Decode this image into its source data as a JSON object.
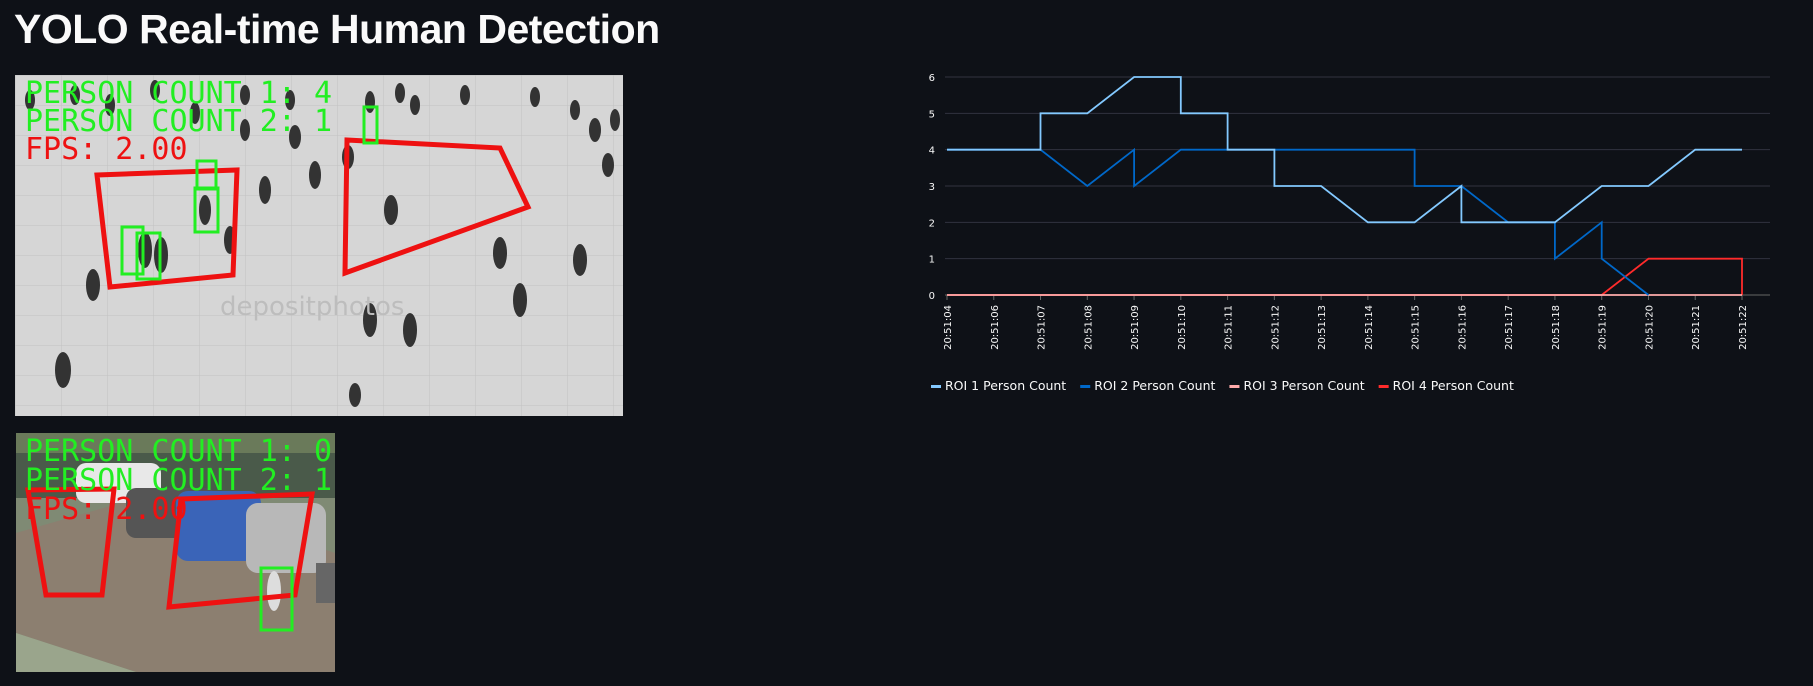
{
  "title": "YOLO Real-time Human Detection",
  "feeds": [
    {
      "overlay": {
        "line1": "PERSON COUNT 1: 4",
        "line2": "PERSON COUNT 2: 1",
        "line3": "FPS: 2.00"
      },
      "watermark": "depositphotos"
    },
    {
      "overlay": {
        "line1": "PERSON COUNT 1: 0",
        "line2": "PERSON COUNT 2: 1",
        "line3": "FPS: 2.00"
      }
    }
  ],
  "colors": {
    "roi1": "#83c9ff",
    "roi2": "#0068c9",
    "roi3": "#ffabab",
    "roi4": "#ff2b2b",
    "box": "#22ee22",
    "roi_poly": "#ee1111"
  },
  "chart_data": {
    "type": "line",
    "x": [
      "20:51:04",
      "20:51:06",
      "20:51:07",
      "20:51:08",
      "20:51:09",
      "20:51:10",
      "20:51:11",
      "20:51:12",
      "20:51:13",
      "20:51:14",
      "20:51:15",
      "20:51:16",
      "20:51:17",
      "20:51:18",
      "20:51:19",
      "20:51:20",
      "20:51:21",
      "20:51:22"
    ],
    "ylim": [
      0,
      6
    ],
    "yticks": [
      0,
      1,
      2,
      3,
      4,
      5,
      6
    ],
    "legend_position": "bottom",
    "series": [
      {
        "name": "ROI 1 Person Count",
        "color": "#83c9ff",
        "points": [
          [
            0,
            4
          ],
          [
            2,
            4
          ],
          [
            2,
            5
          ],
          [
            3,
            5
          ],
          [
            4,
            6
          ],
          [
            5,
            6
          ],
          [
            5,
            5
          ],
          [
            6,
            5
          ],
          [
            6,
            4
          ],
          [
            7,
            4
          ],
          [
            7,
            3
          ],
          [
            8,
            3
          ],
          [
            9,
            2
          ],
          [
            10,
            2
          ],
          [
            11,
            3
          ],
          [
            11,
            2
          ],
          [
            12,
            2
          ],
          [
            13,
            2
          ],
          [
            14,
            3
          ],
          [
            15,
            3
          ],
          [
            16,
            4
          ],
          [
            17,
            4
          ]
        ]
      },
      {
        "name": "ROI 2 Person Count",
        "color": "#0068c9",
        "points": [
          [
            0,
            4
          ],
          [
            2,
            4
          ],
          [
            3,
            3
          ],
          [
            4,
            4
          ],
          [
            4,
            3
          ],
          [
            5,
            4
          ],
          [
            6,
            4
          ],
          [
            7,
            4
          ],
          [
            8,
            4
          ],
          [
            9,
            4
          ],
          [
            10,
            4
          ],
          [
            10,
            3
          ],
          [
            11,
            3
          ],
          [
            12,
            2
          ],
          [
            13,
            2
          ],
          [
            13,
            1
          ],
          [
            14,
            2
          ],
          [
            14,
            1
          ],
          [
            15,
            0
          ]
        ]
      },
      {
        "name": "ROI 3 Person Count",
        "color": "#ffabab",
        "points": [
          [
            0,
            0
          ],
          [
            14,
            0
          ],
          [
            15,
            0
          ],
          [
            16,
            0
          ],
          [
            17,
            0
          ]
        ]
      },
      {
        "name": "ROI 4 Person Count",
        "color": "#ff2b2b",
        "points": [
          [
            0,
            0
          ],
          [
            14,
            0
          ],
          [
            15,
            1
          ],
          [
            16,
            1
          ],
          [
            17,
            1
          ],
          [
            17,
            0
          ]
        ]
      }
    ]
  }
}
